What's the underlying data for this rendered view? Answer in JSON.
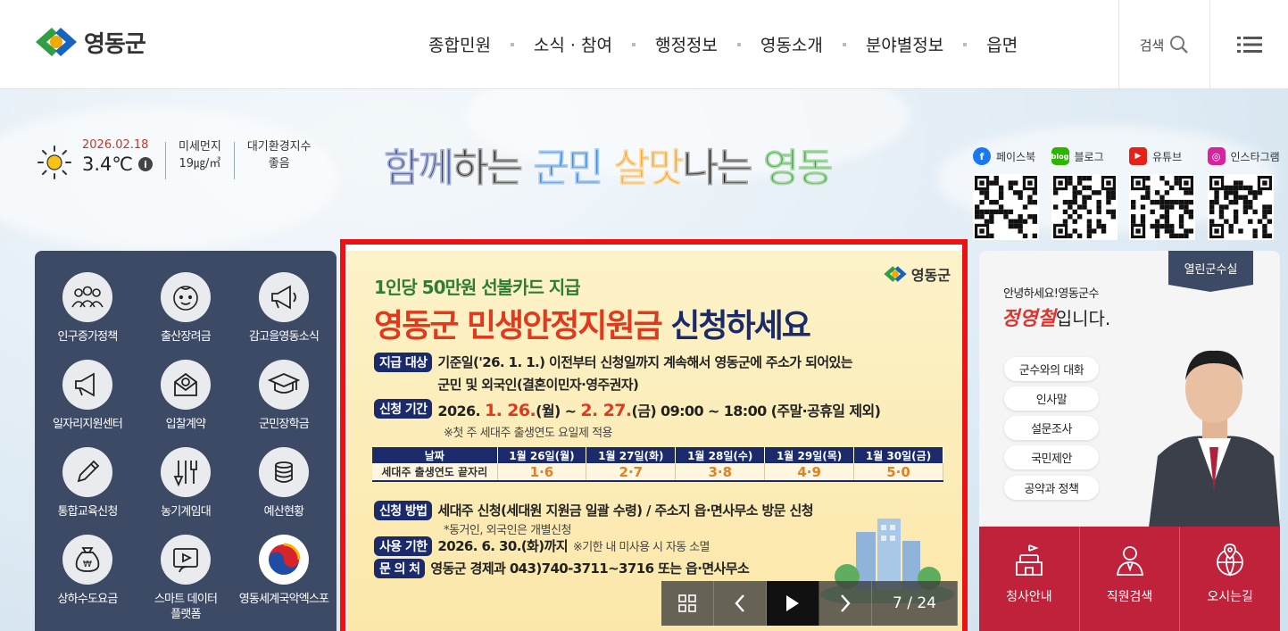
{
  "header": {
    "logo_text": "영동군",
    "nav": [
      "종합민원",
      "소식 · 참여",
      "행정정보",
      "영동소개",
      "분야별정보",
      "읍면"
    ],
    "search_label": "검색"
  },
  "weather": {
    "date": "2026.02.18",
    "temp": "3.4℃",
    "info": "i",
    "dust_label": "미세먼지",
    "dust_value": "19㎍/㎥",
    "air_label": "대기환경지수",
    "air_value": "좋음"
  },
  "slogan": {
    "parts": [
      {
        "text": "함께",
        "color": "#2a3f8f"
      },
      {
        "text": "하는 ",
        "color": "#1a1a1a"
      },
      {
        "text": "군민 ",
        "color": "#2f7fcf"
      },
      {
        "text": "살맛",
        "color": "#f0a020"
      },
      {
        "text": "나는 ",
        "color": "#1a1a1a"
      },
      {
        "text": "영동",
        "color": "#3aa33a"
      }
    ]
  },
  "sns": [
    {
      "label": "페이스북",
      "icon": "facebook-icon",
      "color": "#1877f2",
      "glyph": "f"
    },
    {
      "label": "블로그",
      "icon": "blog-icon",
      "color": "#2db400",
      "glyph": "b"
    },
    {
      "label": "유튜브",
      "icon": "youtube-icon",
      "color": "#e62117",
      "glyph": "▶"
    },
    {
      "label": "인스타그램",
      "icon": "instagram-icon",
      "color": "#d6249f",
      "glyph": "◎"
    }
  ],
  "quick_menu": [
    {
      "label": "인구증가정책",
      "icon": "people-icon"
    },
    {
      "label": "출산장려금",
      "icon": "baby-face-icon"
    },
    {
      "label": "감고을영동소식",
      "icon": "megaphone-icon"
    },
    {
      "label": "일자리지원센터",
      "icon": "megaphone-icon"
    },
    {
      "label": "입찰계약",
      "icon": "envelope-icon"
    },
    {
      "label": "군민장학금",
      "icon": "graduation-cap-icon"
    },
    {
      "label": "통합교육신청",
      "icon": "pencil-icon"
    },
    {
      "label": "농기계임대",
      "icon": "tools-icon"
    },
    {
      "label": "예산현황",
      "icon": "coins-icon"
    },
    {
      "label": "상하수도요금",
      "icon": "money-bag-icon"
    },
    {
      "label": "스마트 데이터\n플랫폼",
      "icon": "tablet-icon"
    },
    {
      "label": "영동세계국악엑스포",
      "icon": "taegeuk-icon"
    }
  ],
  "banner": {
    "logo_text": "영동군",
    "subtitle": "1인당 50만원 선불카드 지급",
    "title_main": "영동군 민생안정지원금",
    "title_end": " 신청하세요",
    "target_tag": "지급 대상",
    "target_text1": "기준일('26. 1. 1.) 이전부터 신청일까지 계속해서 영동군에 주소가 되어있는",
    "target_text2": "군민 및 외국인(결혼이민자·영주권자)",
    "period_tag": "신청 기간",
    "period_a": "2026. ",
    "period_b": "1. 26.",
    "period_c": "(월) ~ ",
    "period_d": "2. 27.",
    "period_e": "(금) 09:00 ~ 18:00 (주말·공휴일 제외)",
    "period_note": "※첫 주 세대주 출생연도 요일제 적용",
    "table_headers": [
      "날짜",
      "1월 26일(월)",
      "1월 27일(화)",
      "1월 28일(수)",
      "1월 29일(목)",
      "1월 30일(금)"
    ],
    "table_row": [
      "세대주 출생연도 끝자리",
      "1·6",
      "2·7",
      "3·8",
      "4·9",
      "5·0"
    ],
    "method_tag": "신청 방법",
    "method_text": "세대주 신청(세대원 지원금 일괄 수령) / 주소지 읍·면사무소 방문 신청",
    "method_note": "*동거인, 외국인은 개별신청",
    "limit_tag": "사용 기한",
    "limit_text": "2026. 6. 30.(화)까지",
    "limit_note": "※기한 내 미사용 시 자동 소멸",
    "contact_tag": "문  의  처",
    "contact_text": "영동군 경제과 043)740-3711~3716 또는 읍·면사무소",
    "counter": "7 / 24"
  },
  "mayor": {
    "tab": "열린군수실",
    "greeting": "안녕하세요!영동군수",
    "name": "정영철",
    "name_suffix": "입니다.",
    "buttons": [
      "군수와의 대화",
      "인사말",
      "설문조사",
      "국민제안",
      "공약과 정책"
    ],
    "bottom": [
      {
        "label": "청사안내",
        "icon": "building-icon"
      },
      {
        "label": "직원검색",
        "icon": "staff-icon"
      },
      {
        "label": "오시는길",
        "icon": "globe-pin-icon"
      }
    ]
  }
}
